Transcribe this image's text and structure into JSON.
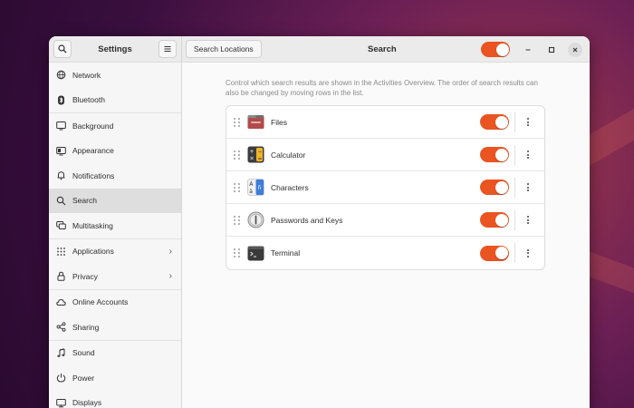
{
  "window": {
    "sidebar_title": "Settings",
    "page_title": "Search",
    "search_locations_label": "Search Locations",
    "search_enabled": true
  },
  "sidebar": {
    "items": [
      {
        "label": "Network",
        "icon": "network-icon"
      },
      {
        "label": "Bluetooth",
        "icon": "bluetooth-icon"
      },
      {
        "label": "Background",
        "icon": "background-icon"
      },
      {
        "label": "Appearance",
        "icon": "appearance-icon"
      },
      {
        "label": "Notifications",
        "icon": "bell-icon"
      },
      {
        "label": "Search",
        "icon": "search-icon",
        "selected": true
      },
      {
        "label": "Multitasking",
        "icon": "multitasking-icon"
      },
      {
        "label": "Applications",
        "icon": "grid-icon",
        "has_submenu": true
      },
      {
        "label": "Privacy",
        "icon": "lock-icon",
        "has_submenu": true
      },
      {
        "label": "Online Accounts",
        "icon": "cloud-icon"
      },
      {
        "label": "Sharing",
        "icon": "share-icon"
      },
      {
        "label": "Sound",
        "icon": "music-note-icon"
      },
      {
        "label": "Power",
        "icon": "power-icon"
      },
      {
        "label": "Displays",
        "icon": "display-icon"
      }
    ]
  },
  "main": {
    "description": "Control which search results are shown in the Activities Overview. The order of search results can also be changed by moving rows in the list.",
    "providers": [
      {
        "label": "Files",
        "icon": "files-icon",
        "enabled": true
      },
      {
        "label": "Calculator",
        "icon": "calculator-icon",
        "enabled": true
      },
      {
        "label": "Characters",
        "icon": "characters-icon",
        "enabled": true
      },
      {
        "label": "Passwords and Keys",
        "icon": "keys-icon",
        "enabled": true
      },
      {
        "label": "Terminal",
        "icon": "terminal-icon",
        "enabled": true
      }
    ]
  },
  "colors": {
    "accent": "#e95420",
    "selected_bg": "#dedede"
  }
}
